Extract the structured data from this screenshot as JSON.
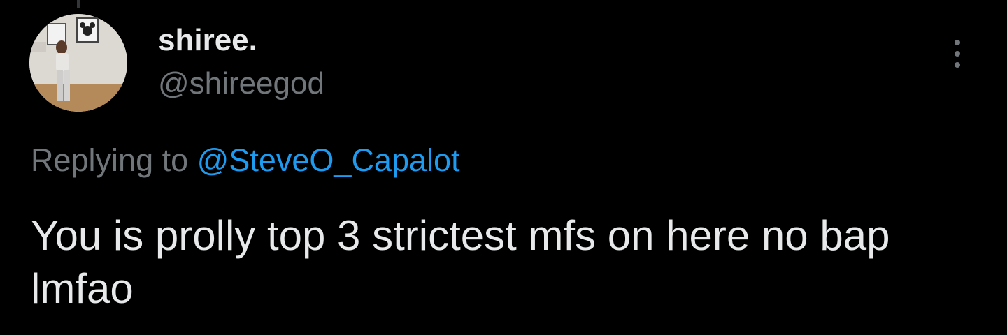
{
  "tweet": {
    "author": {
      "display_name": "shiree.",
      "handle": "@shireegod",
      "avatar_icon": "user-avatar-photo"
    },
    "more_icon": "more-vertical-icon",
    "replying_to_prefix": "Replying to",
    "replying_to_handle": "@SteveO_Capalot",
    "text": "You is prolly top 3 strictest mfs on here no bap lmfao"
  },
  "colors": {
    "background": "#000000",
    "primary_text": "#e7e9ea",
    "secondary_text": "#71767b",
    "link": "#1d9bf0"
  }
}
